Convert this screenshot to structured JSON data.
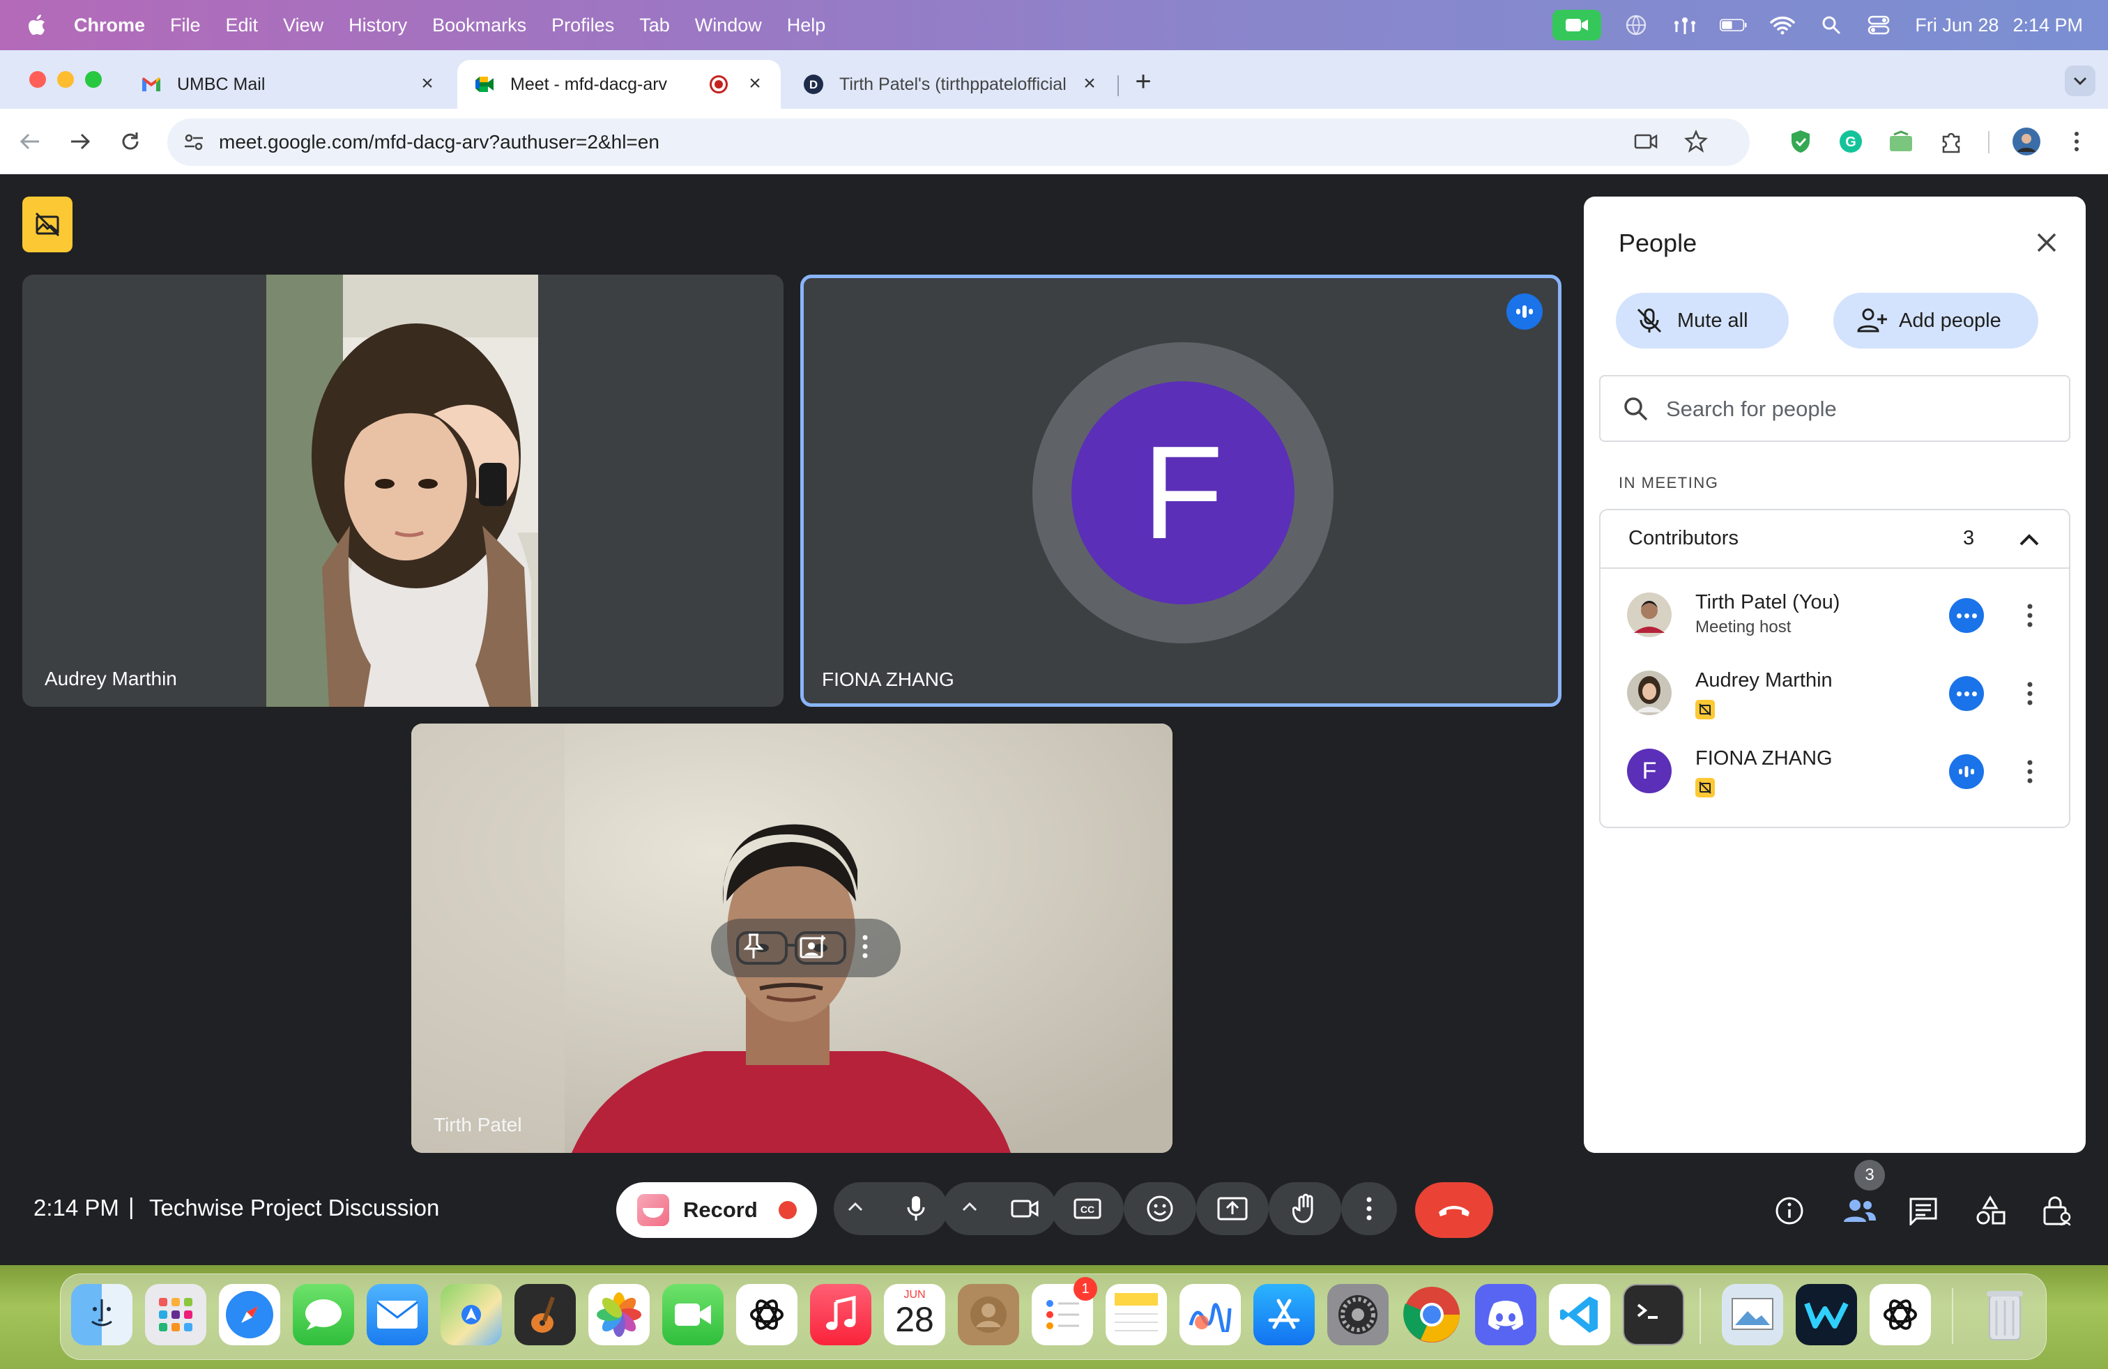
{
  "menubar": {
    "app": "Chrome",
    "items": [
      "File",
      "Edit",
      "View",
      "History",
      "Bookmarks",
      "Profiles",
      "Tab",
      "Window",
      "Help"
    ],
    "date": "Fri Jun 28",
    "time": "2:14 PM"
  },
  "tabs": [
    {
      "title": "UMBC Mail",
      "icon": "gmail-icon"
    },
    {
      "title": "Meet - mfd-dacg-arv",
      "icon": "meet-icon"
    },
    {
      "title": "Tirth Patel's (tirthppatelofficial",
      "icon": "discord-icon"
    }
  ],
  "address": {
    "url": "meet.google.com/mfd-dacg-arv?authuser=2&hl=en"
  },
  "tiles": {
    "audrey": {
      "name": "Audrey Marthin"
    },
    "fiona": {
      "name": "FIONA ZHANG",
      "initial": "F"
    },
    "tirth": {
      "name": "Tirth Patel"
    }
  },
  "people_panel": {
    "title": "People",
    "mute_all": "Mute all",
    "add_people": "Add people",
    "search_placeholder": "Search for people",
    "section": "IN MEETING",
    "group": {
      "label": "Contributors",
      "count": "3"
    },
    "participants": [
      {
        "name": "Tirth Patel (You)",
        "sub": "Meeting host"
      },
      {
        "name": "Audrey Marthin",
        "sub": ""
      },
      {
        "name": "FIONA ZHANG",
        "sub": "",
        "initial": "F"
      }
    ]
  },
  "bottom": {
    "time": "2:14 PM",
    "separator": "|",
    "meeting_name": "Techwise Project Discussion",
    "record_label": "Record",
    "people_count": "3"
  },
  "dock": {
    "calendar_month": "JUN",
    "calendar_day": "28",
    "reminders_badge": "1"
  },
  "colors": {
    "meet_bg": "#202124",
    "tile_bg": "#3c4043",
    "accent_blue": "#1a73e8",
    "purple_avatar": "#5b2fb8",
    "end_call_red": "#ea4335"
  }
}
